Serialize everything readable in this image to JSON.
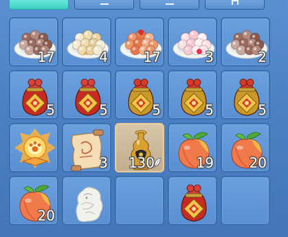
{
  "tabs": [
    {
      "id": "tab-1",
      "active": true
    },
    {
      "id": "tab-2",
      "active": false,
      "glyph": "dash"
    },
    {
      "id": "tab-3",
      "active": false,
      "glyph": "dash"
    },
    {
      "id": "tab-4",
      "active": false,
      "glyph": "box"
    }
  ],
  "inventory": {
    "rows": [
      [
        {
          "item": "dumplings-plate-brown-icon",
          "qty": "17"
        },
        {
          "item": "dumplings-plate-cream-icon",
          "qty": "4"
        },
        {
          "item": "dumplings-plate-orange-icon",
          "qty": "17"
        },
        {
          "item": "dumplings-plate-pink-icon",
          "qty": "3"
        },
        {
          "item": "dumplings-plate-brown-icon",
          "qty": "2"
        }
      ],
      [
        {
          "item": "red-lucky-bag-icon",
          "qty": "5"
        },
        {
          "item": "red-lucky-bag-icon",
          "qty": "5"
        },
        {
          "item": "gold-lucky-bag-icon",
          "qty": "5"
        },
        {
          "item": "gold-lucky-bag-icon",
          "qty": "5"
        },
        {
          "item": "gold-lucky-bag-icon",
          "qty": "5"
        }
      ],
      [
        {
          "item": "glowing-paw-orb-icon",
          "qty": ""
        },
        {
          "item": "scroll-map-icon",
          "qty": "3"
        },
        {
          "item": "golden-vase-icon",
          "qty": "130",
          "selected": true,
          "leaf": true
        },
        {
          "item": "peach-icon",
          "qty": "19"
        },
        {
          "item": "peach-icon",
          "qty": "20"
        }
      ],
      [
        {
          "item": "peach-icon",
          "qty": "20"
        },
        {
          "item": "jade-beast-statue-icon",
          "qty": ""
        },
        {
          "item": "empty-slot",
          "qty": ""
        },
        {
          "item": "red-lucky-bag-icon",
          "qty": ""
        },
        {
          "item": "empty-slot",
          "qty": ""
        }
      ]
    ]
  },
  "colors": {
    "panel_bg": "#4a7fc2",
    "slot_bg": "#5a90d2",
    "slot_border": "#3c6fb0",
    "selected_bg": "#c2ad8e",
    "active_tab": "#3fd0c4"
  }
}
